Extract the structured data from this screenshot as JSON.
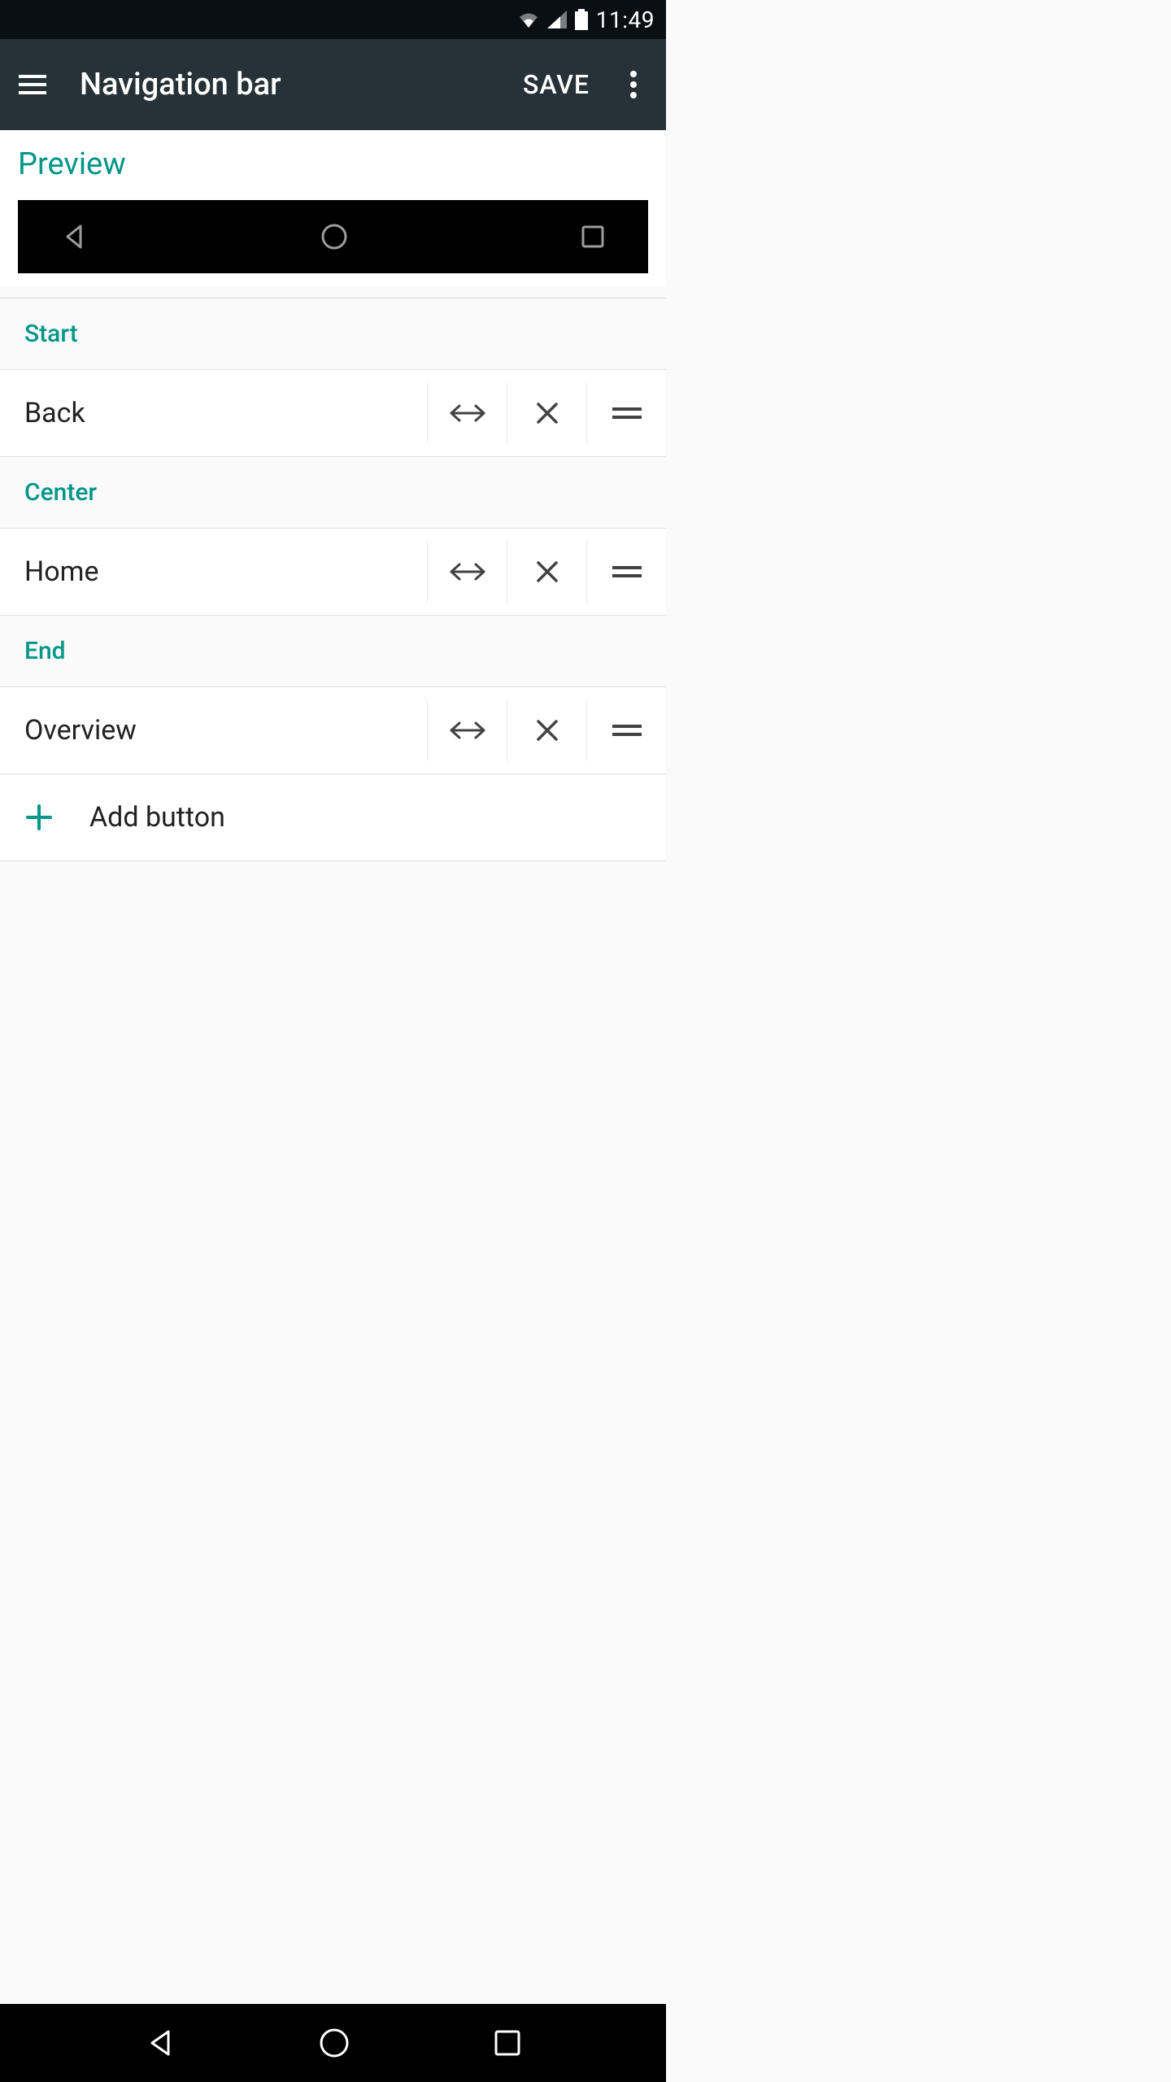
{
  "status": {
    "time": "11:49"
  },
  "appbar": {
    "title": "Navigation bar",
    "save": "SAVE"
  },
  "preview": {
    "title": "Preview"
  },
  "sections": {
    "start": {
      "header": "Start",
      "item": "Back"
    },
    "center": {
      "header": "Center",
      "item": "Home"
    },
    "end": {
      "header": "End",
      "item": "Overview"
    }
  },
  "add": {
    "label": "Add button"
  }
}
